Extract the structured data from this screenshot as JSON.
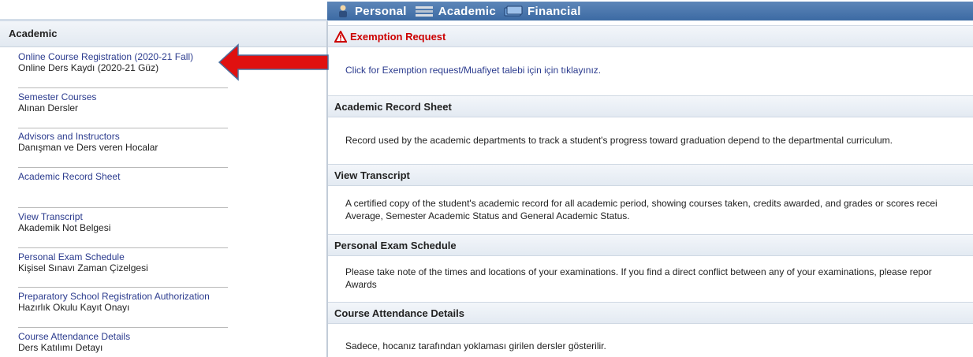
{
  "nav": {
    "items": [
      {
        "label": "Personal",
        "icon": "person-icon"
      },
      {
        "label": "Academic",
        "icon": "books-icon"
      },
      {
        "label": "Financial",
        "icon": "money-icon"
      }
    ]
  },
  "sidebar": {
    "title": "Academic",
    "items": [
      {
        "en": "Online Course Registration (2020-21 Fall)",
        "tr": "Online Ders Kaydı (2020-21 Güz)"
      },
      {
        "en": "Semester Courses",
        "tr": "Alınan Dersler"
      },
      {
        "en": "Advisors and Instructors",
        "tr": "Danışman ve Ders veren Hocalar"
      },
      {
        "en": "Academic Record Sheet",
        "tr": ""
      },
      {
        "en": "View Transcript",
        "tr": "Akademik Not Belgesi"
      },
      {
        "en": "Personal Exam Schedule",
        "tr": "Kişisel Sınavı Zaman Çizelgesi"
      },
      {
        "en": "Preparatory School Registration Authorization",
        "tr": "Hazırlık Okulu Kayıt Onayı"
      },
      {
        "en": "Course Attendance Details",
        "tr": "Ders Katılımı Detayı"
      }
    ]
  },
  "main": {
    "sections": [
      {
        "title": "Exemption Request",
        "text": "Click for Exemption request/Muafiyet talebi için için tıklayınız."
      },
      {
        "title": "Academic Record Sheet",
        "text": "Record used by the academic departments to track a student's progress toward graduation depend to the departmental curriculum."
      },
      {
        "title": "View Transcript",
        "text": "A certified copy of the student's academic record for all academic period, showing courses taken, credits awarded, and grades or scores recei\nAverage, Semester Academic Status and General Academic Status."
      },
      {
        "title": "Personal Exam Schedule",
        "text": "Please take note of the times and locations of your examinations. If you find a direct conflict between any of your examinations, please repor\nAwards"
      },
      {
        "title": "Course Attendance Details",
        "text": "Sadece, hocanız tarafından yoklaması girilen dersler gösterilir."
      }
    ]
  },
  "colors": {
    "nav_bg": "#4a76ad",
    "link": "#2b3b8e",
    "section_title_alert": "#cc0000",
    "arrow": "#e01010"
  }
}
